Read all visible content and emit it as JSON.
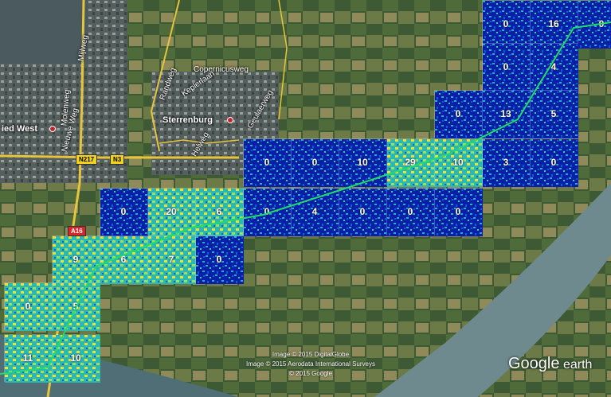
{
  "places": {
    "city_west": "ied West",
    "city_center": "Sterrenburg"
  },
  "streets": {
    "copernicusweg": "Copernicusweg",
    "keplerlaan": "Keplerlaan",
    "randweg": "Randweg",
    "geulaerweg": "Geulaerweg",
    "helweg": "Helweg",
    "nieuwe_weg": "Nieuwe Weg",
    "molenweg": "Molenweg",
    "mijlweg": "Mijlweg"
  },
  "road_shields": {
    "n217": "N217",
    "n3": "N3",
    "a16": "A16"
  },
  "tile_counts": {
    "r0": [
      "0",
      "16",
      "0"
    ],
    "r1": [
      "0",
      "4"
    ],
    "r2": [
      "0",
      "13",
      "5"
    ],
    "r3": [
      "0",
      "0",
      "10",
      "29",
      "10",
      "3",
      "0"
    ],
    "r4": [
      "0",
      "20",
      "6",
      "0",
      "4",
      "0",
      "0",
      "0"
    ],
    "r5": [
      "9",
      "6",
      "7",
      "0"
    ],
    "r6": [
      "0",
      "5"
    ],
    "r7": [
      "11",
      "10"
    ]
  },
  "credits": {
    "line1": "Image © 2015 DigitalGlobe",
    "line2": "Image © 2015 Aerodata International Surveys",
    "line3": "© 2015 Google"
  },
  "logo": {
    "google": "Google",
    "earth": "earth"
  },
  "colors": {
    "heat_low": "#0a1fa8",
    "heat_mid": "#1fb3c9",
    "heat_high": "#e8e23a",
    "river": "#6f8a8e",
    "track": "#22dd66"
  }
}
